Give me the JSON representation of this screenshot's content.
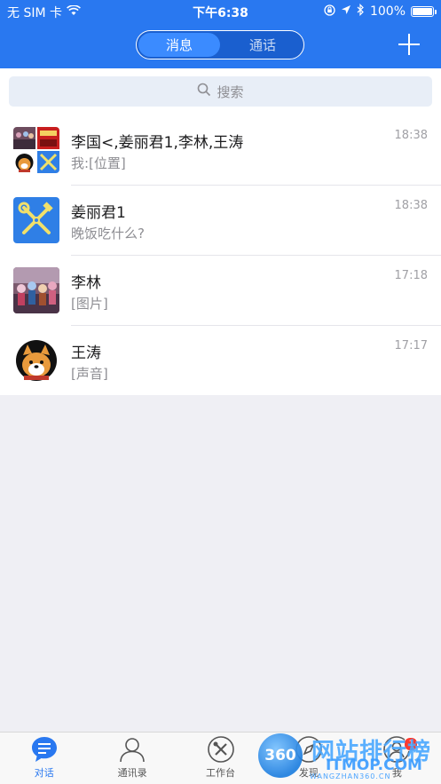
{
  "status_bar": {
    "carrier": "无 SIM 卡",
    "time": "下午6:38",
    "battery": "100%",
    "battery_level": 1.0
  },
  "nav": {
    "segments": [
      "消息",
      "通话"
    ],
    "active_segment": 0
  },
  "search": {
    "placeholder": "搜索"
  },
  "conversations": [
    {
      "title": "李国<,姜丽君1,李林,王涛",
      "preview": "我:[位置]",
      "time": "18:38",
      "avatar": "group-avatar"
    },
    {
      "title": "姜丽君1",
      "preview": "晚饭吃什么?",
      "time": "18:38",
      "avatar": "blue-tools-avatar"
    },
    {
      "title": "李林",
      "preview": "[图片]",
      "time": "17:18",
      "avatar": "crowd-photo-avatar"
    },
    {
      "title": "王涛",
      "preview": "[声音]",
      "time": "17:17",
      "avatar": "shiba-dog-avatar"
    }
  ],
  "tabbar": {
    "items": [
      {
        "label": "对话",
        "icon": "chat-bubble-icon"
      },
      {
        "label": "通讯录",
        "icon": "contacts-icon"
      },
      {
        "label": "工作台",
        "icon": "workbench-icon"
      },
      {
        "label": "发现",
        "icon": "discover-compass-icon"
      },
      {
        "label": "我",
        "icon": "me-icon",
        "badge": "1"
      }
    ],
    "active": 0
  },
  "watermark": {
    "logo_text": "360",
    "site_name": "网站排行榜",
    "domain": "ITMOP.COM",
    "small_text": "WANGZHAN360.CN"
  },
  "colors": {
    "primary": "#2978f0",
    "background": "#efeff4",
    "tab_active": "#2978f0"
  }
}
